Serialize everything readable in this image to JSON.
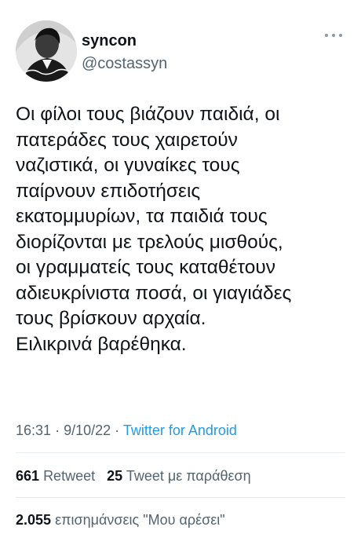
{
  "author": {
    "display_name": "syncon",
    "handle": "@costassyn",
    "avatar_icon": "profile-photo",
    "more_icon": "more-horizontal-icon"
  },
  "tweet": {
    "text": "Οι φίλοι τους βιάζουν παιδιά, οι\nπατεράδες τους χαιρετούν\nναζιστικά, οι γυναίκες τους\nπαίρνουν επιδοτήσεις\nεκατομμυρίων, τα παιδιά τους\nδιορίζονται με τρελούς μισθούς,\nοι γραμματείς τους καταθέτουν\nαδιευκρίνιστα ποσά, οι γιαγιάδες\nτους βρίσκουν αρχαία.\nΕιλικρινά βαρέθηκα."
  },
  "meta": {
    "time": "16:31",
    "separator1": "·",
    "date": "9/10/22",
    "separator2": "·",
    "source": "Twitter for Android"
  },
  "stats": {
    "retweets_count": "661",
    "retweets_label": "Retweet",
    "quotes_count": "25",
    "quotes_label": "Tweet με παράθεση",
    "likes_count": "2.055",
    "likes_label": "επισημάνσεις \"Μου αρέσει\""
  },
  "colors": {
    "text": "#0f1419",
    "secondary": "#536471",
    "link": "#1d9bf0",
    "divider": "#e6ecf0"
  }
}
